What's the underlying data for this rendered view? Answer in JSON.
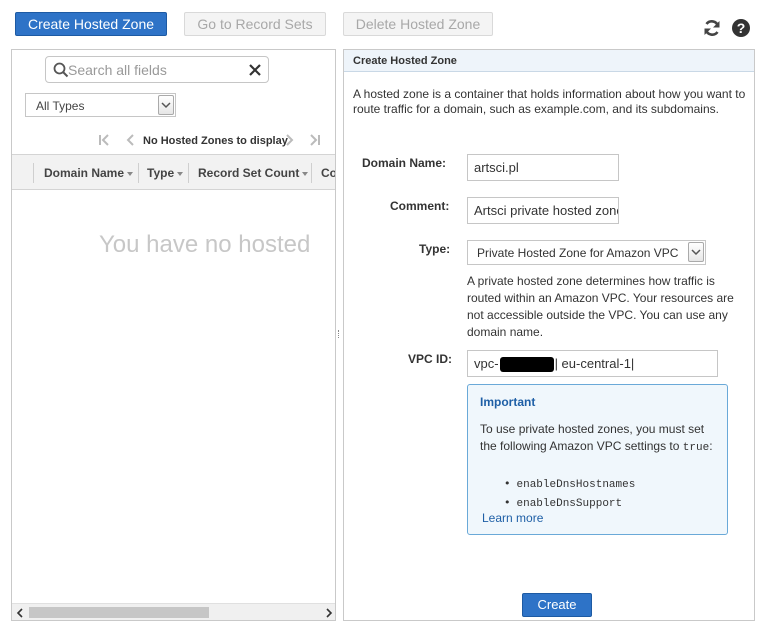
{
  "toolbar": {
    "create_hosted_zone": "Create Hosted Zone",
    "go_to_record_sets": "Go to Record Sets",
    "delete_hosted_zone": "Delete Hosted Zone",
    "refresh_icon": "refresh-icon",
    "help_icon": "help-icon"
  },
  "left": {
    "search_placeholder": "Search all fields",
    "type_filter": "All Types",
    "pager_text": "No Hosted Zones to display",
    "columns": [
      "Domain Name",
      "Type",
      "Record Set Count",
      "Co"
    ],
    "empty_message": "You have no hosted"
  },
  "form": {
    "title": "Create Hosted Zone",
    "intro": "A hosted zone is a container that holds information about how you want to route traffic for a domain, such as example.com, and its subdomains.",
    "domain_label": "Domain Name:",
    "domain_value": "artsci.pl",
    "comment_label": "Comment:",
    "comment_value": "Artsci private hosted zone",
    "type_label": "Type:",
    "type_value": "Private Hosted Zone for Amazon VPC",
    "type_help": "A private hosted zone determines how traffic is routed within an Amazon VPC. Your resources are not accessible outside the VPC. You can use any domain name.",
    "vpc_label": "VPC ID:",
    "vpc_prefix": "vpc-",
    "vpc_suffix": "| eu-central-1|",
    "important_title": "Important",
    "important_body": "To use private hosted zones, you must set the following Amazon VPC settings to",
    "important_true": "true",
    "settings": [
      "enableDnsHostnames",
      "enableDnsSupport"
    ],
    "learn_more": "Learn more",
    "create_button": "Create"
  },
  "colors": {
    "primary_button": "#2e73c7",
    "panel_header": "#eef4fa",
    "info_border": "#6aa9d8",
    "link": "#1e5fa6"
  }
}
